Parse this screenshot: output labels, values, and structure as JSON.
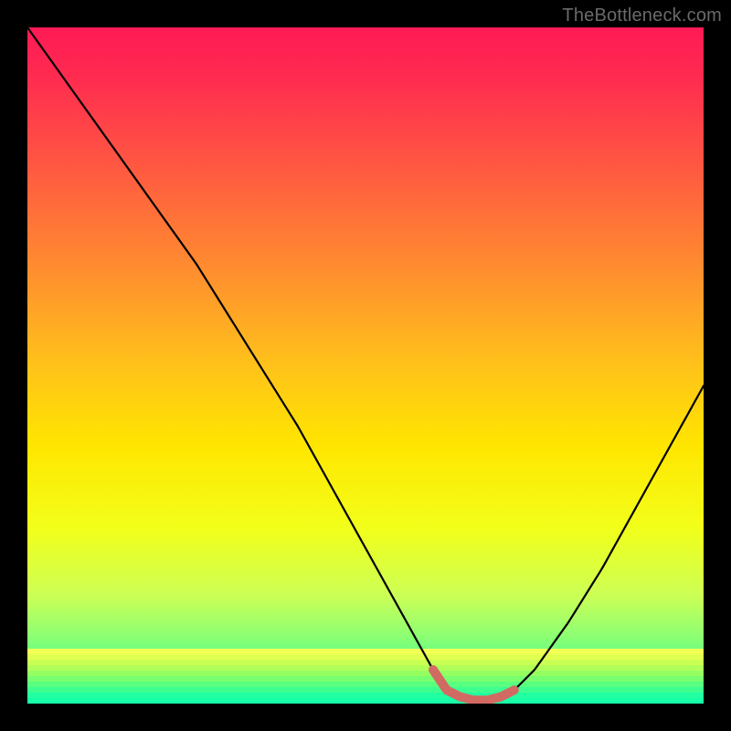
{
  "watermark": "TheBottleneck.com",
  "colors": {
    "background": "#000000",
    "curve": "#000000",
    "marker": "#d16a62",
    "gradient_stops": [
      {
        "offset": 0.0,
        "color": "#ff1a55"
      },
      {
        "offset": 0.07,
        "color": "#ff2a50"
      },
      {
        "offset": 0.2,
        "color": "#ff5642"
      },
      {
        "offset": 0.35,
        "color": "#ff8a30"
      },
      {
        "offset": 0.5,
        "color": "#ffc21a"
      },
      {
        "offset": 0.62,
        "color": "#ffe600"
      },
      {
        "offset": 0.74,
        "color": "#f2ff1a"
      },
      {
        "offset": 0.84,
        "color": "#ccff55"
      },
      {
        "offset": 0.9,
        "color": "#8dff72"
      },
      {
        "offset": 0.95,
        "color": "#4fff90"
      },
      {
        "offset": 1.0,
        "color": "#18ffa8"
      }
    ],
    "bottom_bands": [
      "#f2ff55",
      "#e0ff50",
      "#c8ff52",
      "#b0ff58",
      "#95ff62",
      "#78ff70",
      "#58ff80",
      "#3cff90",
      "#22ffa0",
      "#18ffa8"
    ]
  },
  "chart_data": {
    "type": "line",
    "title": "",
    "xlabel": "",
    "ylabel": "",
    "xlim": [
      0,
      100
    ],
    "ylim": [
      0,
      100
    ],
    "grid": false,
    "x": [
      0,
      5,
      10,
      15,
      20,
      25,
      30,
      35,
      40,
      45,
      50,
      55,
      60,
      62,
      64,
      66,
      68,
      70,
      72,
      75,
      80,
      85,
      90,
      95,
      100
    ],
    "values": [
      100,
      93,
      86,
      79,
      72,
      65,
      57,
      49,
      41,
      32,
      23,
      14,
      5,
      2,
      1,
      0.5,
      0.5,
      1,
      2,
      5,
      12,
      20,
      29,
      38,
      47
    ],
    "optimal_range_x": [
      60,
      72
    ],
    "optimal_range_y": 1
  }
}
